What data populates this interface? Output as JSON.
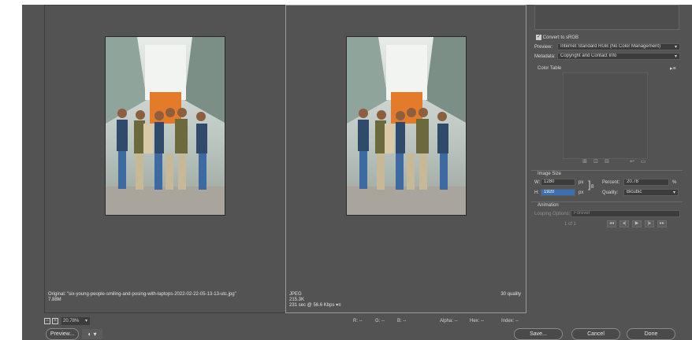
{
  "original_info": {
    "line1": "Original: \"six-young-people-smiling-and-posing-with-laptops-2022-02-22-05-13-13-utc.jpg\"",
    "line2": "7.88M"
  },
  "optimized_info": {
    "format": "JPEG",
    "size": "215.3K",
    "time": "231 sec @ 56.6 Kbps",
    "quality": "30 quality"
  },
  "settings": {
    "convert_srgb_label": "Convert to sRGB",
    "preview_label": "Preview:",
    "preview_value": "Internet Standard RGB (No Color Management)",
    "metadata_label": "Metadata:",
    "metadata_value": "Copyright and Contact Info"
  },
  "color_table": {
    "title": "Color Table"
  },
  "image_size": {
    "title": "Image Size",
    "w_label": "W:",
    "w_value": "1280",
    "h_label": "H:",
    "h_value": "1920",
    "unit": "px",
    "percent_label": "Percent:",
    "percent_value": "20.78",
    "percent_unit": "%",
    "quality_label": "Quality:",
    "quality_value": "Bicubic"
  },
  "animation": {
    "title": "Animation",
    "looping_label": "Looping Options:",
    "looping_value": "Forever",
    "frame_counter": "1 of 1"
  },
  "status_bar": {
    "zoom": "20.78%",
    "r": "R: --",
    "g": "G: --",
    "b": "B: --",
    "alpha": "Alpha: --",
    "hex": "Hex: --",
    "index": "Index: --"
  },
  "footer": {
    "preview_btn": "Preview...",
    "save_btn": "Save...",
    "cancel_btn": "Cancel",
    "done_btn": "Done"
  },
  "colors": {
    "bg": "#535353",
    "panel": "#4b4b4b",
    "field": "#3c3c3c",
    "highlight": "#3b6fb6"
  }
}
